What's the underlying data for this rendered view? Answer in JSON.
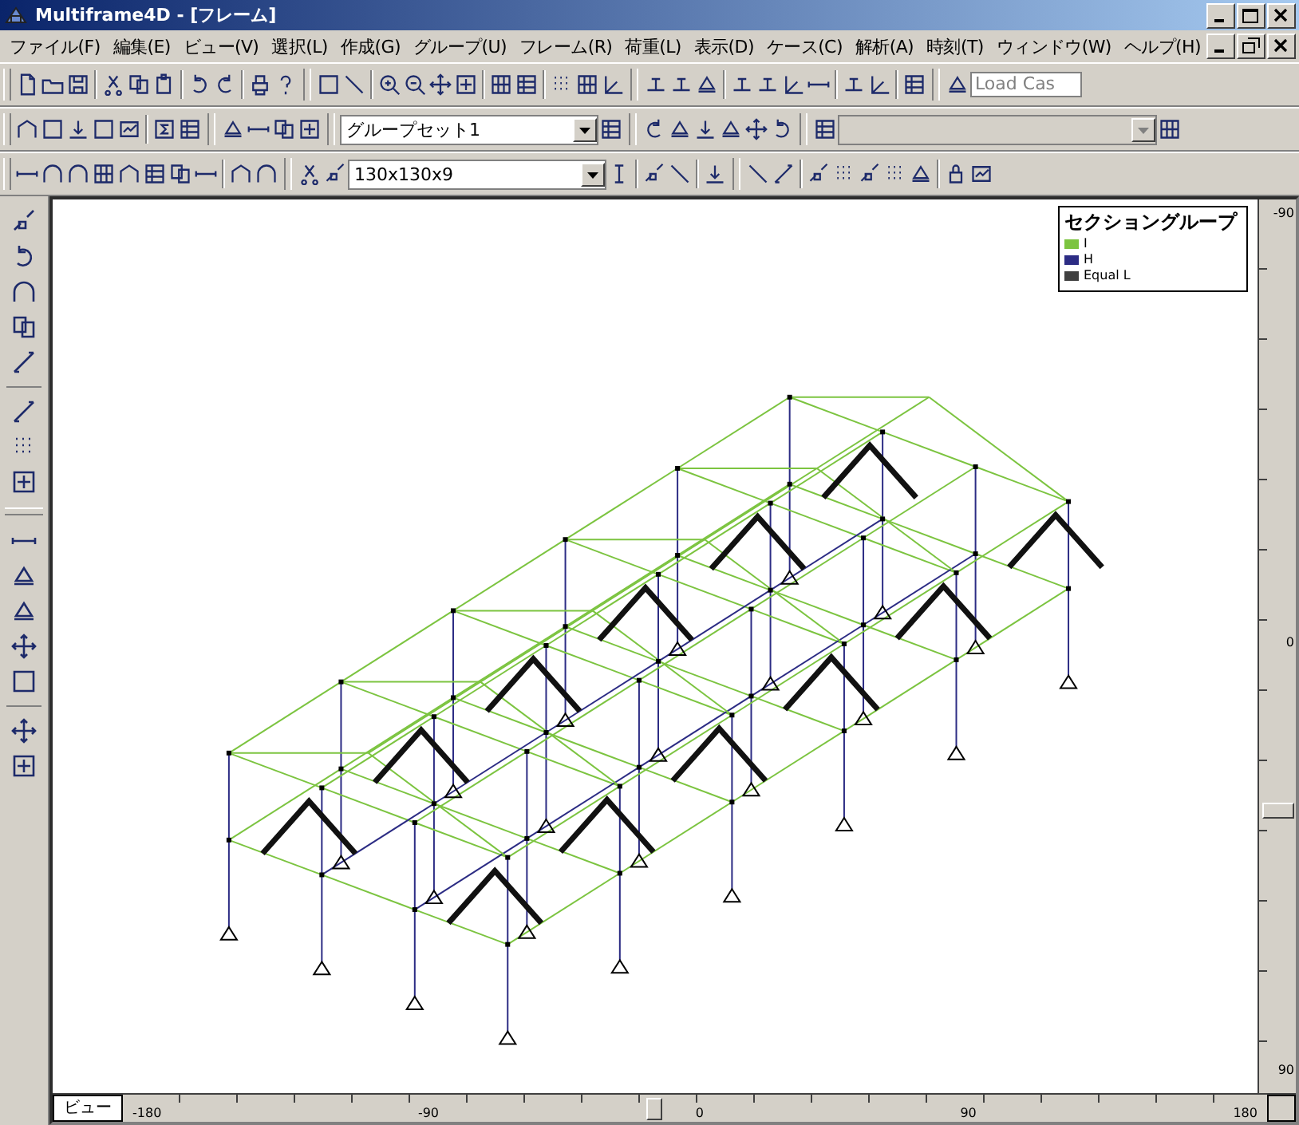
{
  "window": {
    "title": "Multiframe4D - [フレーム]"
  },
  "menu": [
    "ファイル(F)",
    "編集(E)",
    "ビュー(V)",
    "選択(L)",
    "作成(G)",
    "グループ(U)",
    "フレーム(R)",
    "荷重(L)",
    "表示(D)",
    "ケース(C)",
    "解析(A)",
    "時刻(T)",
    "ウィンドウ(W)",
    "ヘルプ(H)"
  ],
  "toolbar": {
    "load_case": {
      "placeholder": "Load Cas"
    },
    "group_set": {
      "value": "グループセット1"
    },
    "section": {
      "value": "130x130x9"
    }
  },
  "legend": {
    "title": "セクショングループ",
    "items": [
      {
        "label": "I",
        "color": "#7cc440"
      },
      {
        "label": "H",
        "color": "#2c2c84"
      },
      {
        "label": "Equal L",
        "color": "#404040"
      }
    ]
  },
  "view_tab": {
    "label": "ビュー"
  },
  "rulers": {
    "vertical": [
      "-90",
      "0",
      "90"
    ],
    "horizontal": [
      "-180",
      "-90",
      "0",
      "90",
      "180"
    ]
  }
}
